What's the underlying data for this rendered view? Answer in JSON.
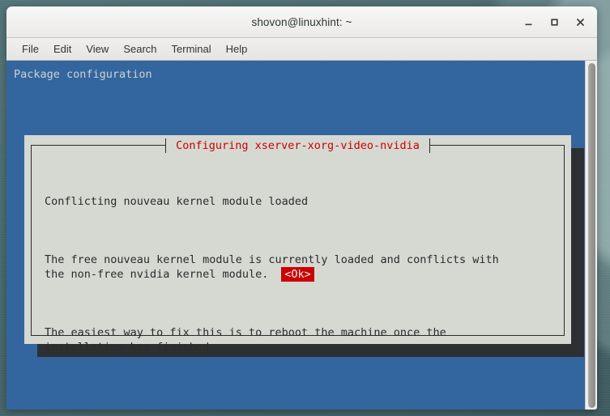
{
  "desktop": {
    "wallpaper_color": "#4a6b6b"
  },
  "window": {
    "title": "shovon@linuxhint: ~",
    "controls": {
      "minimize": "minimize-icon",
      "maximize": "maximize-icon",
      "close": "close-icon"
    }
  },
  "menubar": {
    "items": [
      {
        "label": "File"
      },
      {
        "label": "Edit"
      },
      {
        "label": "View"
      },
      {
        "label": "Search"
      },
      {
        "label": "Terminal"
      },
      {
        "label": "Help"
      }
    ]
  },
  "terminal": {
    "background_color": "#33669e",
    "header_text": "Package configuration",
    "header_color": "#cfd2cf"
  },
  "dialog": {
    "title": "Configuring xserver-xorg-video-nvidia",
    "title_color": "#cc0000",
    "background_color": "#d5d9d2",
    "paragraphs": [
      "Conflicting nouveau kernel module loaded",
      "The free nouveau kernel module is currently loaded and conflicts with\nthe non-free nvidia kernel module.",
      "The easiest way to fix this is to reboot the machine once the\ninstallation has finished."
    ],
    "button": {
      "label": "<Ok>",
      "background_color": "#cc0000",
      "text_color": "#f2f2f2",
      "selected": true
    }
  },
  "scrollbar": {
    "thumb_color": "#9a9691"
  }
}
